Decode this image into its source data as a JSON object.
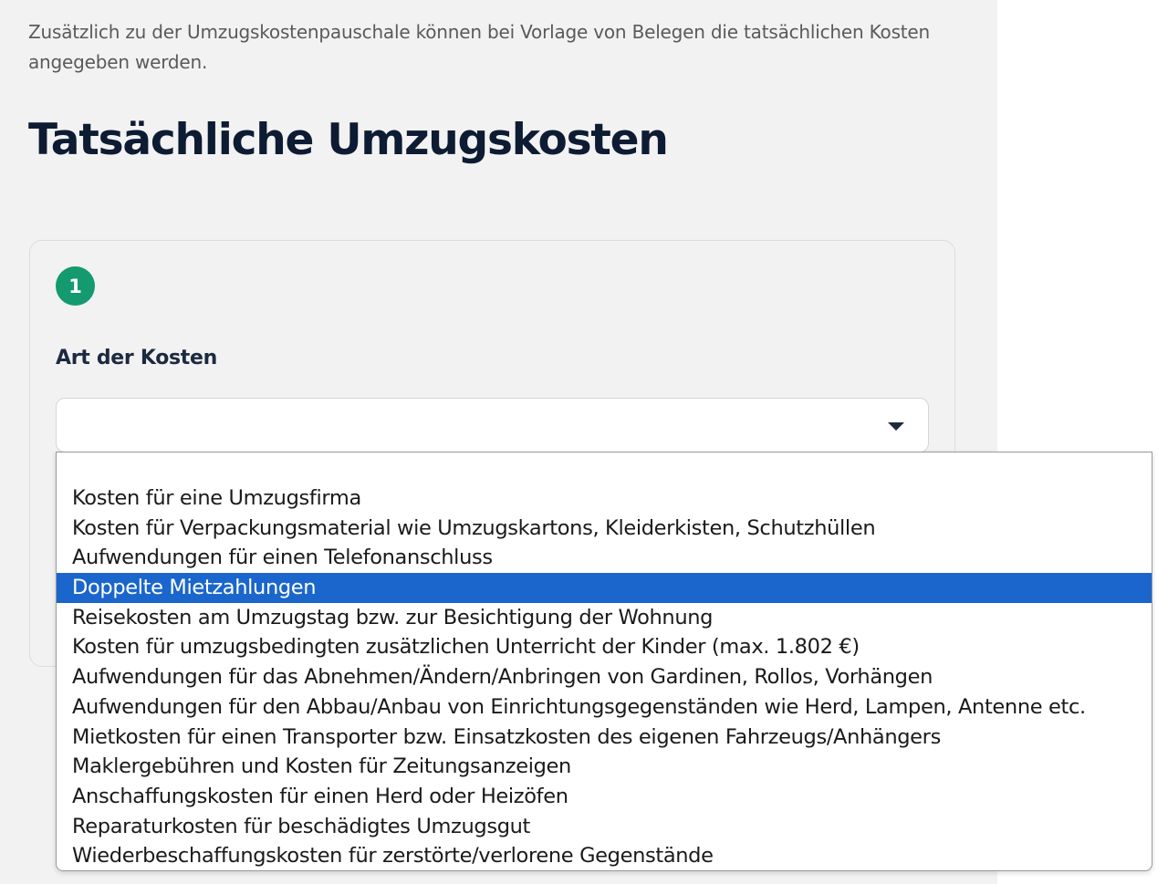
{
  "intro_text": "Zusätzlich zu der Umzugskostenpauschale können bei Vorlage von Belegen die tatsächlichen Kosten angegeben werden.",
  "heading": "Tatsächliche Umzugskosten",
  "card": {
    "step_number": "1",
    "step_color": "#149a6e",
    "field_label": "Art der Kosten",
    "select": {
      "value": "",
      "icon": "chevron-down-icon"
    }
  },
  "dropdown": {
    "selected_index": 3,
    "highlight_color": "#1a66cc",
    "options": [
      "Kosten für eine Umzugsfirma",
      "Kosten für Verpackungsmaterial wie Umzugskartons, Kleiderkisten, Schutzhüllen",
      "Aufwendungen für einen Telefonanschluss",
      "Doppelte Mietzahlungen",
      "Reisekosten am Umzugstag bzw. zur Besichtigung der Wohnung",
      "Kosten für umzugsbedingten zusätzlichen Unterricht der Kinder (max. 1.802 €)",
      "Aufwendungen für das Abnehmen/Ändern/Anbringen von Gardinen, Rollos, Vorhängen",
      "Aufwendungen für den Abbau/Anbau von Einrichtungsgegenständen wie Herd, Lampen, Antenne etc.",
      "Mietkosten für einen Transporter bzw. Einsatzkosten des eigenen Fahrzeugs/Anhängers",
      "Maklergebühren und Kosten für Zeitungsanzeigen",
      "Anschaffungskosten für einen Herd oder Heizöfen",
      "Reparaturkosten für beschädigtes Umzugsgut",
      "Wiederbeschaffungskosten für zerstörte/verlorene Gegenstände"
    ]
  }
}
